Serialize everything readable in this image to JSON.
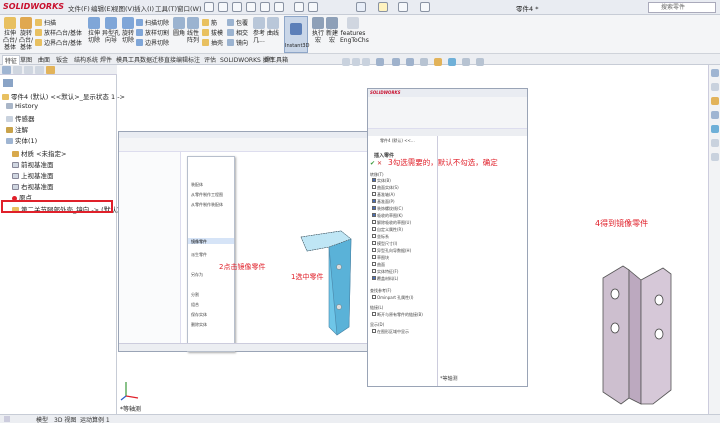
{
  "app": {
    "logo": "SOLIDWORKS",
    "document_title": "零件4 *",
    "search_placeholder": "搜索零件"
  },
  "menu": [
    "文件(F)",
    "编辑(E)",
    "视图(V)",
    "插入(I)",
    "工具(T)",
    "窗口(W)"
  ],
  "ribbon": {
    "big_buttons": [
      {
        "label": "拉伸凸台/基体",
        "short": "拉伸\n凸台/\n基体"
      },
      {
        "label": "旋转凸台/基体",
        "short": "旋转\n凸台/\n基体"
      },
      {
        "label": "拉伸切除",
        "short": "拉伸\n切除"
      },
      {
        "label": "异型孔向导",
        "short": "异型孔\n向导"
      },
      {
        "label": "旋转切除",
        "short": "旋转\n切除"
      },
      {
        "label": "圆角",
        "short": "圆角"
      },
      {
        "label": "线性阵列",
        "short": "线性\n阵列"
      },
      {
        "label": "参考几何体",
        "short": "参考\n几..."
      },
      {
        "label": "曲线",
        "short": "曲线"
      },
      {
        "label": "Instant3D",
        "short": "Instant3D"
      },
      {
        "label": "执行宏",
        "short": "执行\n宏"
      },
      {
        "label": "新建宏",
        "short": "新建\n宏"
      },
      {
        "label": "features EngToChs",
        "short": "features\nEngToChs"
      }
    ],
    "small_col1": [
      "扫描",
      "放样凸台/基体",
      "边界凸台/基体"
    ],
    "small_col2": [
      "扫描切除",
      "放样切割",
      "边界切除"
    ],
    "small_col3": [
      "筋",
      "拔模",
      "抽壳"
    ],
    "small_col4": [
      "包覆",
      "相交",
      "镜向"
    ]
  },
  "tabs": [
    "特征",
    "草图",
    "曲面",
    "钣金",
    "结构系统",
    "焊件",
    "模具工具",
    "数据迁移",
    "直接编辑",
    "标注",
    "评估",
    "SOLIDWORKS 插件",
    "焊工具箱"
  ],
  "tree": {
    "root": "零件4 (默认) <<默认>_显示状态 1 ->",
    "items": [
      "History",
      "传感器",
      "注解",
      "实体(1)",
      "材质 <未指定>",
      "前视基准面",
      "上视基准面",
      "右视基准面",
      "原点",
      "第二关节腿部外壳_镜向 -> (默认)"
    ]
  },
  "bottom_tabs": [
    "模型",
    "3D 视图",
    "运动算例 1"
  ],
  "view_label": "*等轴测",
  "screenshot1": {
    "annotation_mirror": "2点击镜像零件",
    "annotation_select": "1选中零件",
    "menu_items": [
      "装配体",
      "从零件制作工程图",
      "从零件制作装配体",
      "镜像零件",
      "派生零件",
      "另存为",
      "分割",
      "组合",
      "保存实体",
      "删除实体"
    ],
    "highlight_item": "镜像零件",
    "view_label": "*等轴测"
  },
  "screenshot2": {
    "title": "零件4 (默认) <<...",
    "panel_title": "插入零件",
    "annotation": "3勾选需要的，默认不勾选，确定",
    "section_transfer": "转移(T)",
    "options": [
      "实体(B)",
      "曲面实体(S)",
      "基准轴(A)",
      "基准面(P)",
      "装饰螺纹线(C)",
      "吸收的草图(K)",
      "解除吸收的草图(U)",
      "自定义属性(R)",
      "坐标系",
      "模型尺寸(I)",
      "异型孔向导数据(H)",
      "草图块",
      "曲面",
      "实体特征(F)",
      "覆盖材料(L)"
    ],
    "options_on": [
      0,
      3,
      4,
      5,
      14
    ],
    "section_find": "查找参考(F)",
    "find_option": "Ominpart 孔属性(I)",
    "section_link": "链接(L)",
    "link_option": "断开与原有零件的链接(B)",
    "section_display": "显示(D)",
    "display_option": "在图形区域中显示",
    "view_label": "*等轴测"
  },
  "result_annotation": "4得到镜像零件",
  "colors": {
    "accent": "#e0202a",
    "part_blue": "#6ec6e8",
    "part_mauve": "#c8b8cc",
    "highlight": "#4a6fb5"
  }
}
